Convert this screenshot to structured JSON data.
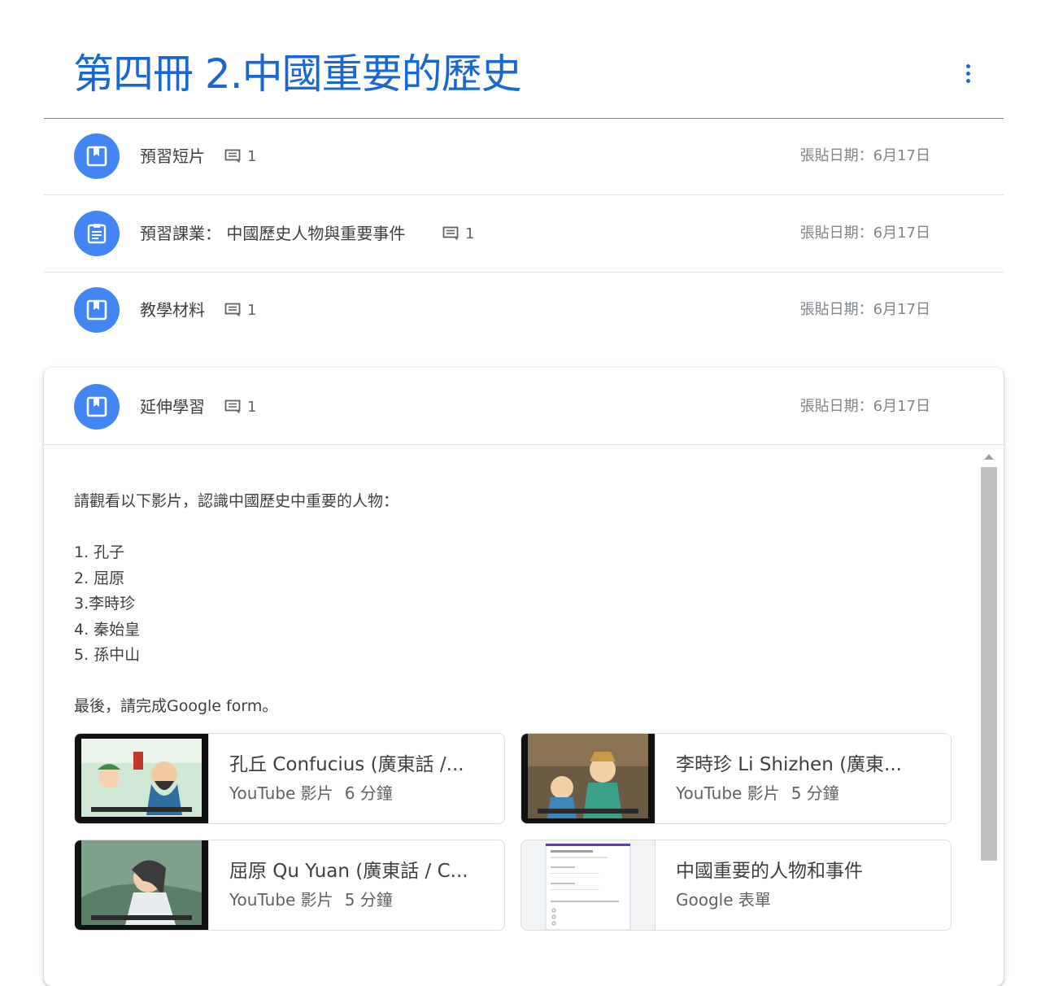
{
  "topic": {
    "title": "第四冊 2.中國重要的歷史"
  },
  "items": [
    {
      "title": "預習短片",
      "comments": "1",
      "date": "張貼日期：6月17日",
      "icon": "book-icon"
    },
    {
      "title": "預習課業：  中國歷史人物與重要事件",
      "comments": "1",
      "date": "張貼日期：6月17日",
      "icon": "assignment-icon"
    },
    {
      "title": "教學材料",
      "comments": "1",
      "date": "張貼日期：6月17日",
      "icon": "book-icon"
    }
  ],
  "expanded": {
    "title": "延伸學習",
    "comments": "1",
    "date": "張貼日期：6月17日",
    "icon": "book-icon",
    "description": {
      "intro": "請觀看以下影片，認識中國歷史中重要的人物：",
      "list": [
        "1. 孔子",
        "2. 屈原",
        "3.李時珍",
        "4. 秦始皇",
        "5. 孫中山"
      ],
      "outro": "最後，請完成Google form。"
    },
    "attachments": [
      {
        "title": "孔丘 Confucius (廣東話 /...",
        "type": "YouTube 影片",
        "length": "6 分鐘",
        "thumb": "video-thumbnail"
      },
      {
        "title": "李時珍 Li Shizhen (廣東...",
        "type": "YouTube 影片",
        "length": "5 分鐘",
        "thumb": "video-thumbnail"
      },
      {
        "title": "屈原 Qu Yuan (廣東話 / C...",
        "type": "YouTube 影片",
        "length": "5 分鐘",
        "thumb": "video-thumbnail"
      },
      {
        "title": "中國重要的人物和事件",
        "type": "Google 表單",
        "length": "",
        "thumb": "form-thumbnail"
      }
    ]
  },
  "colors": {
    "accent": "#1967d2",
    "icon_bg": "#4285f4",
    "divider": "#e0e0e0"
  }
}
